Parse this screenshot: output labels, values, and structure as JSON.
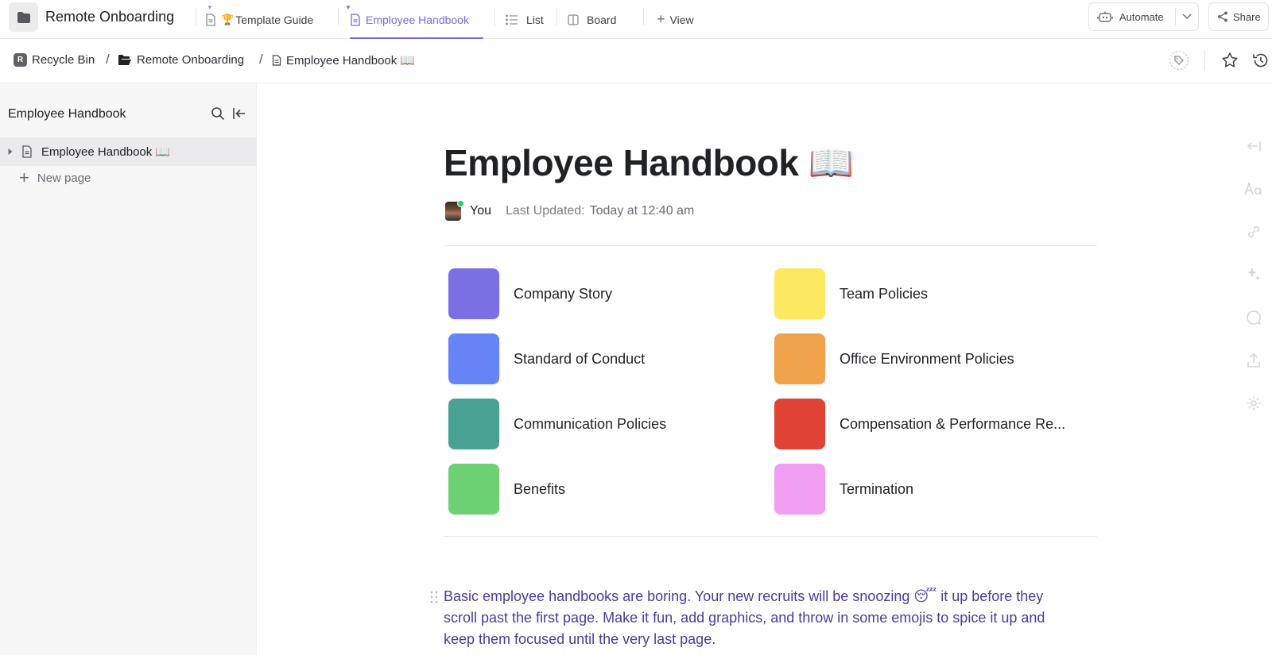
{
  "topbar": {
    "title": "Remote Onboarding",
    "tabs": [
      {
        "label": "Template Guide",
        "emoji": "🏆"
      },
      {
        "label": "Employee Handbook"
      },
      {
        "label": "List"
      },
      {
        "label": "Board"
      },
      {
        "label": "View"
      }
    ],
    "automate_label": "Automate",
    "share_label": "Share"
  },
  "breadcrumb": {
    "items": [
      {
        "label": "Recycle Bin",
        "badge": "R"
      },
      {
        "label": "Remote Onboarding"
      },
      {
        "label": "Employee Handbook 📖"
      }
    ],
    "separator": "/"
  },
  "sidebar": {
    "title": "Employee Handbook",
    "pages": [
      {
        "label": "Employee Handbook 📖"
      }
    ],
    "new_page_label": "New page"
  },
  "document": {
    "title": "Employee Handbook 📖",
    "author": "You",
    "updated_label": "Last Updated:",
    "updated_value": "Today at 12:40 am",
    "sections": [
      {
        "label": "Company Story",
        "color": "#7b6fe6"
      },
      {
        "label": "Team Policies",
        "color": "#fde95f"
      },
      {
        "label": "Standard of Conduct",
        "color": "#6784f7"
      },
      {
        "label": "Office Environment Policies",
        "color": "#f0a24a"
      },
      {
        "label": "Communication Policies",
        "color": "#48a193"
      },
      {
        "label": "Compensation & Performance Re...",
        "color": "#e14236"
      },
      {
        "label": "Benefits",
        "color": "#6dd174"
      },
      {
        "label": "Termination",
        "color": "#f19ef2"
      }
    ],
    "paragraph": "Basic employee handbooks are boring. Your new recruits will be snoozing 😴  it up before they scroll past the first page. Make it fun, add graphics, and throw in some emojis to spice it up and keep them focused until the very last page."
  },
  "colors": {
    "accent": "#7b68ee",
    "paragraph_text": "#4b3aa3"
  }
}
